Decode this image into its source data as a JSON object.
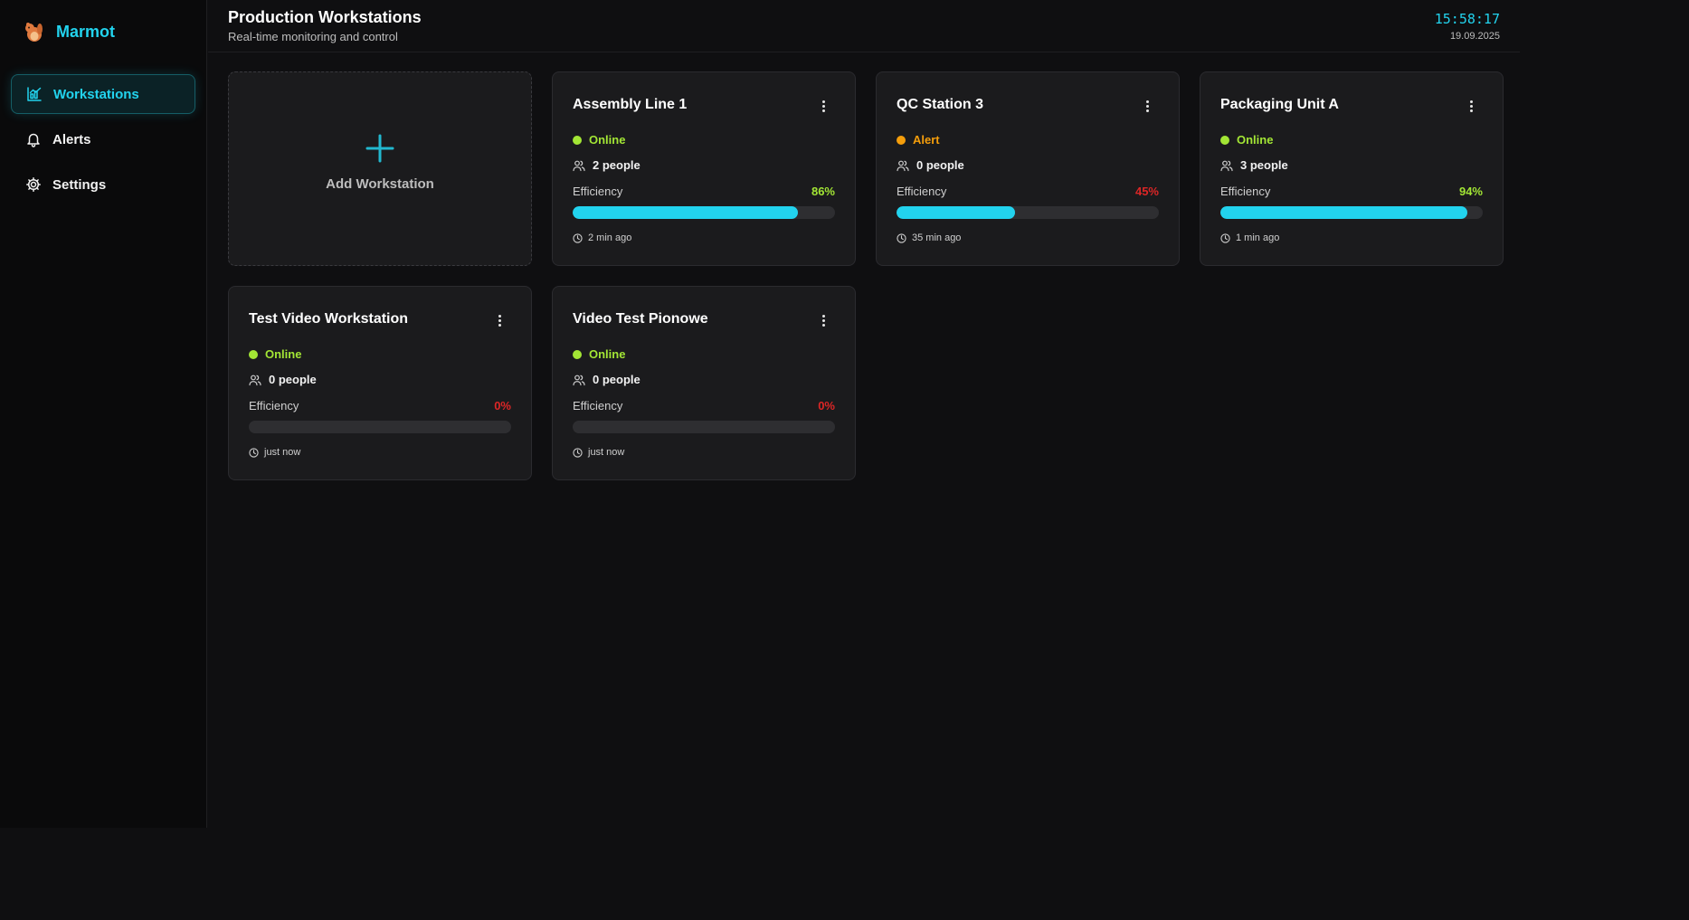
{
  "app": {
    "name": "Marmot"
  },
  "sidebar": {
    "items": [
      {
        "label": "Workstations",
        "icon": "chart-icon",
        "active": true
      },
      {
        "label": "Alerts",
        "icon": "bell-icon",
        "active": false
      },
      {
        "label": "Settings",
        "icon": "gear-icon",
        "active": false
      }
    ]
  },
  "header": {
    "title": "Production Workstations",
    "subtitle": "Real-time monitoring and control",
    "time": "15:58:17",
    "date": "19.09.2025"
  },
  "add_card": {
    "label": "Add Workstation"
  },
  "efficiency_label": "Efficiency",
  "colors": {
    "accent": "#22d3ee",
    "online": "#a3e635",
    "alert": "#f59e0b",
    "low": "#dc2626"
  },
  "workstations": [
    {
      "name": "Assembly Line 1",
      "status": "Online",
      "status_color": "#a3e635",
      "people": "2 people",
      "efficiency": "86%",
      "efficiency_fraction": 0.86,
      "efficiency_color": "#a3e635",
      "updated": "2 min ago"
    },
    {
      "name": "QC Station 3",
      "status": "Alert",
      "status_color": "#f59e0b",
      "people": "0 people",
      "efficiency": "45%",
      "efficiency_fraction": 0.45,
      "efficiency_color": "#dc2626",
      "updated": "35 min ago"
    },
    {
      "name": "Packaging Unit A",
      "status": "Online",
      "status_color": "#a3e635",
      "people": "3 people",
      "efficiency": "94%",
      "efficiency_fraction": 0.94,
      "efficiency_color": "#a3e635",
      "updated": "1 min ago"
    },
    {
      "name": "Test Video Workstation",
      "status": "Online",
      "status_color": "#a3e635",
      "people": "0 people",
      "efficiency": "0%",
      "efficiency_fraction": 0,
      "efficiency_color": "#dc2626",
      "updated": "just now"
    },
    {
      "name": "Video Test Pionowe",
      "status": "Online",
      "status_color": "#a3e635",
      "people": "0 people",
      "efficiency": "0%",
      "efficiency_fraction": 0,
      "efficiency_color": "#dc2626",
      "updated": "just now"
    }
  ]
}
